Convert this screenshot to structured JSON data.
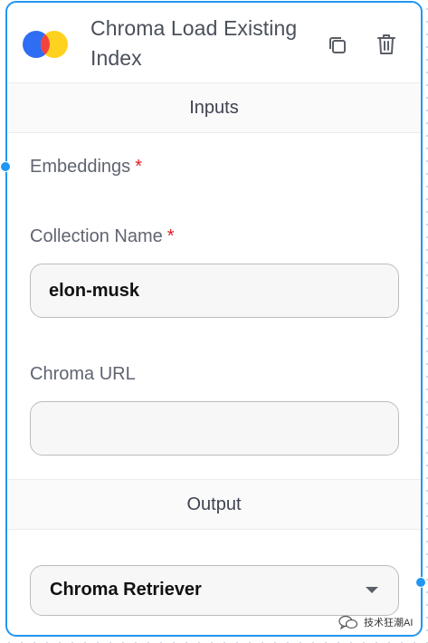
{
  "node": {
    "title": "Chroma Load Existing Index",
    "icons": {
      "logo": "chroma-logo-icon",
      "duplicate": "copy-icon",
      "delete": "trash-icon"
    }
  },
  "sections": {
    "inputs": "Inputs",
    "output": "Output"
  },
  "inputs": {
    "embeddings": {
      "label": "Embeddings",
      "required_mark": "*"
    },
    "collection_name": {
      "label": "Collection Name",
      "required_mark": "*",
      "value": "elon-musk"
    },
    "chroma_url": {
      "label": "Chroma URL",
      "value": ""
    }
  },
  "output": {
    "selected": "Chroma Retriever"
  },
  "watermark": {
    "text": "技术狂潮AI",
    "icon": "wechat-icon"
  },
  "colors": {
    "accent": "#2196f3",
    "required": "#e11d24",
    "logo_blue": "#2f6df3",
    "logo_red": "#f4433f",
    "logo_yellow": "#ffd21f"
  }
}
